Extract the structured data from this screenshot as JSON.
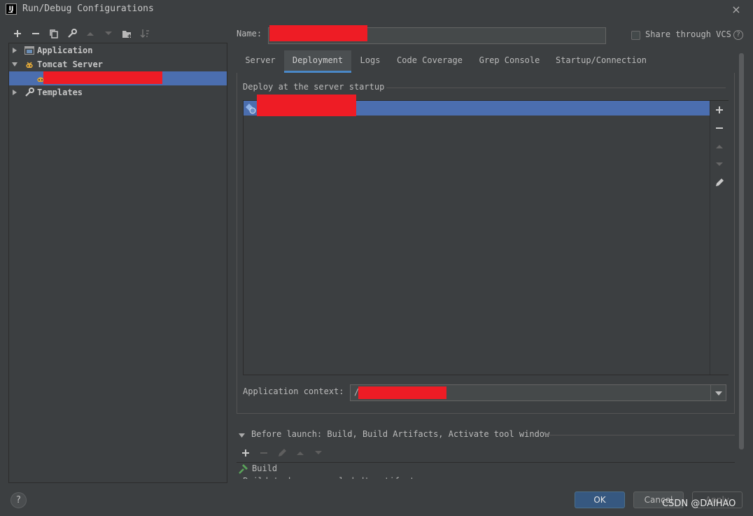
{
  "window": {
    "title": "Run/Debug Configurations",
    "close_glyph": "×",
    "app_icon_text": "IJ"
  },
  "toolbar": {
    "icons": [
      "add-icon",
      "remove-icon",
      "copy-icon",
      "wrench-icon",
      "move-up-icon",
      "move-down-icon",
      "new-folder-icon",
      "sort-icon"
    ]
  },
  "tree": {
    "items": [
      {
        "label": "Application",
        "expanded": false
      },
      {
        "label": "Tomcat Server",
        "expanded": true
      },
      {
        "label": "",
        "selected": true
      },
      {
        "label": "Templates",
        "expanded": false
      }
    ]
  },
  "form": {
    "name_label": "Name:",
    "share_label": "Share through VCS",
    "share_checked": false,
    "help_glyph": "?"
  },
  "tabs": [
    {
      "label": "Server",
      "active": false
    },
    {
      "label": "Deployment",
      "active": true
    },
    {
      "label": "Logs",
      "active": false
    },
    {
      "label": "Code Coverage",
      "active": false
    },
    {
      "label": "Grep Console",
      "active": false
    },
    {
      "label": "Startup/Connection",
      "active": false
    }
  ],
  "deployment": {
    "section_label": "Deploy at the server startup",
    "side_buttons": [
      "add-icon",
      "remove-icon",
      "move-up-icon",
      "move-down-icon",
      "edit-icon"
    ],
    "context_label": "Application context:",
    "context_value": "/"
  },
  "before_launch": {
    "label": "Before launch: Build, Build Artifacts, Activate tool window",
    "items": [
      "Build",
      "Build 'web: war exploded' artifact"
    ]
  },
  "buttons": {
    "ok": "OK",
    "cancel": "Cancel",
    "apply": "Apply",
    "help": "?"
  },
  "watermark": "CSDN @DAIHAO",
  "colors": {
    "selection": "#4b6eaf",
    "tab_underline": "#4a88c7",
    "ok_button": "#365880",
    "redaction": "#ee1c25"
  }
}
